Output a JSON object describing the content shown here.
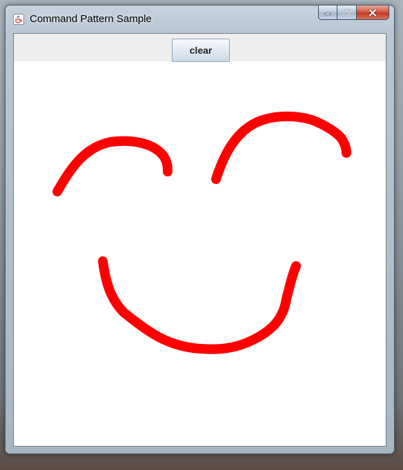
{
  "window": {
    "title": "Command Pattern Sample",
    "app_icon": "java-cup-icon",
    "controls": [
      "minimize-icon",
      "maximize-icon",
      "close-icon"
    ]
  },
  "toolbar": {
    "clear_label": "clear"
  },
  "drawing": {
    "stroke_color": "#ff0000",
    "background": "#ffffff"
  }
}
